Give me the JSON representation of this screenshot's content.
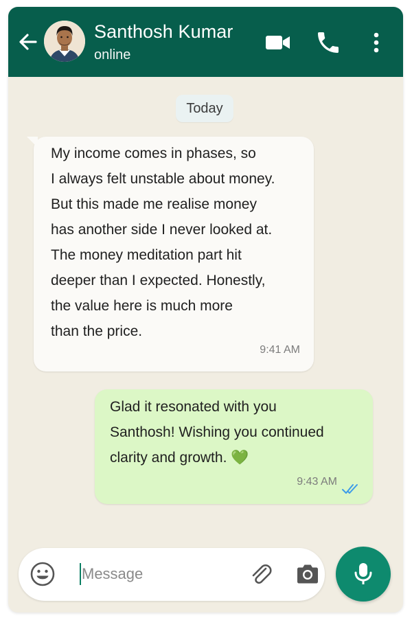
{
  "header": {
    "contact_name": "Santhosh Kumar",
    "status": "online",
    "back_icon": "arrow-left-icon",
    "avatar_icon": "contact-avatar",
    "actions": [
      "video-call-icon",
      "voice-call-icon",
      "more-vert-icon"
    ]
  },
  "chat": {
    "date_label": "Today",
    "messages": [
      {
        "direction": "incoming",
        "text": "My income comes in phases, so\nI always felt unstable about money.\nBut this made me realise money\nhas another side I never looked at.\nThe money meditation part hit\ndeeper than I expected. Honestly,\nthe value here is much more\nthan the price.",
        "time": "9:41 AM"
      },
      {
        "direction": "outgoing",
        "text": "Glad it resonated with you\nSanthosh! Wishing you continued\nclarity and growth. 💚",
        "time": "9:43 AM",
        "status_icon": "double-check-read-icon"
      }
    ]
  },
  "composer": {
    "placeholder": "Message",
    "value": "",
    "icons": [
      "emoji-icon",
      "attach-icon",
      "camera-icon",
      "mic-icon"
    ]
  },
  "colors": {
    "header": "#075e4c",
    "chat_background": "#f1ede2",
    "incoming_bubble": "#fbfaf7",
    "outgoing_bubble": "#dcf7c6",
    "accent": "#0e8a6e",
    "read_ticks": "#3d9be9"
  }
}
